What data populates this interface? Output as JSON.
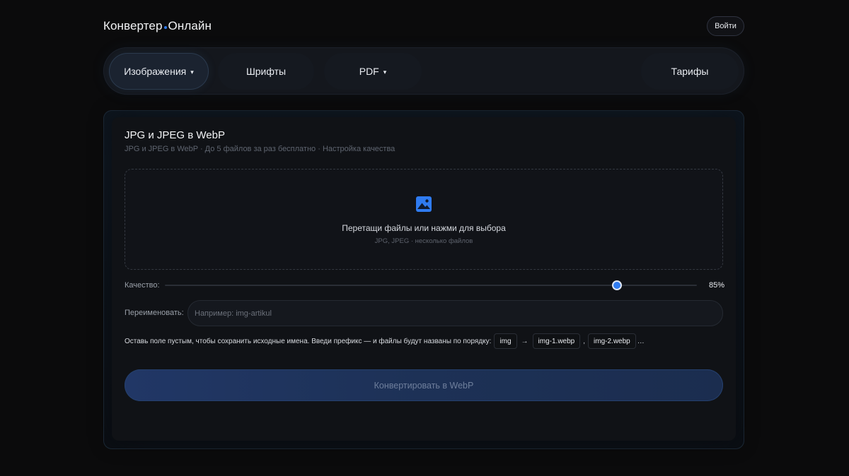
{
  "header": {
    "logo_part1": "Конвертер",
    "logo_part2": "Онлайн",
    "login_label": "Войти"
  },
  "nav": {
    "items": [
      {
        "label": "Изображения",
        "caret": "▾"
      },
      {
        "label": "Шрифты"
      },
      {
        "label": "PDF",
        "caret": "▾"
      },
      {
        "label": "Тарифы"
      }
    ]
  },
  "card": {
    "title": "JPG и JPEG в WebP",
    "subtitle": "JPG и JPEG в WebP · До 5 файлов за раз бесплатно · Настройка качества"
  },
  "dropzone": {
    "icon": "image-icon",
    "text": "Перетащи файлы или нажми для выбора",
    "hint": "JPG, JPEG · несколько файлов"
  },
  "quality": {
    "label": "Качество:",
    "value_percent": 85,
    "value_label": "85%"
  },
  "rename": {
    "label": "Переименовать:",
    "placeholder": "Например: img-artikul",
    "value": ""
  },
  "hint": {
    "text": "Оставь поле пустым, чтобы сохранить исходные имена. Введи префикс — и файлы будут названы по порядку:",
    "chip_prefix": "img",
    "arrow": "→",
    "chip_file1": "img-1.webp",
    "comma": ",",
    "chip_file2": "img-2.webp",
    "ellipsis": "…"
  },
  "convert": {
    "label": "Конвертировать в WebP"
  },
  "colors": {
    "accent": "#2f7bf0",
    "background": "#0b0b0c"
  }
}
